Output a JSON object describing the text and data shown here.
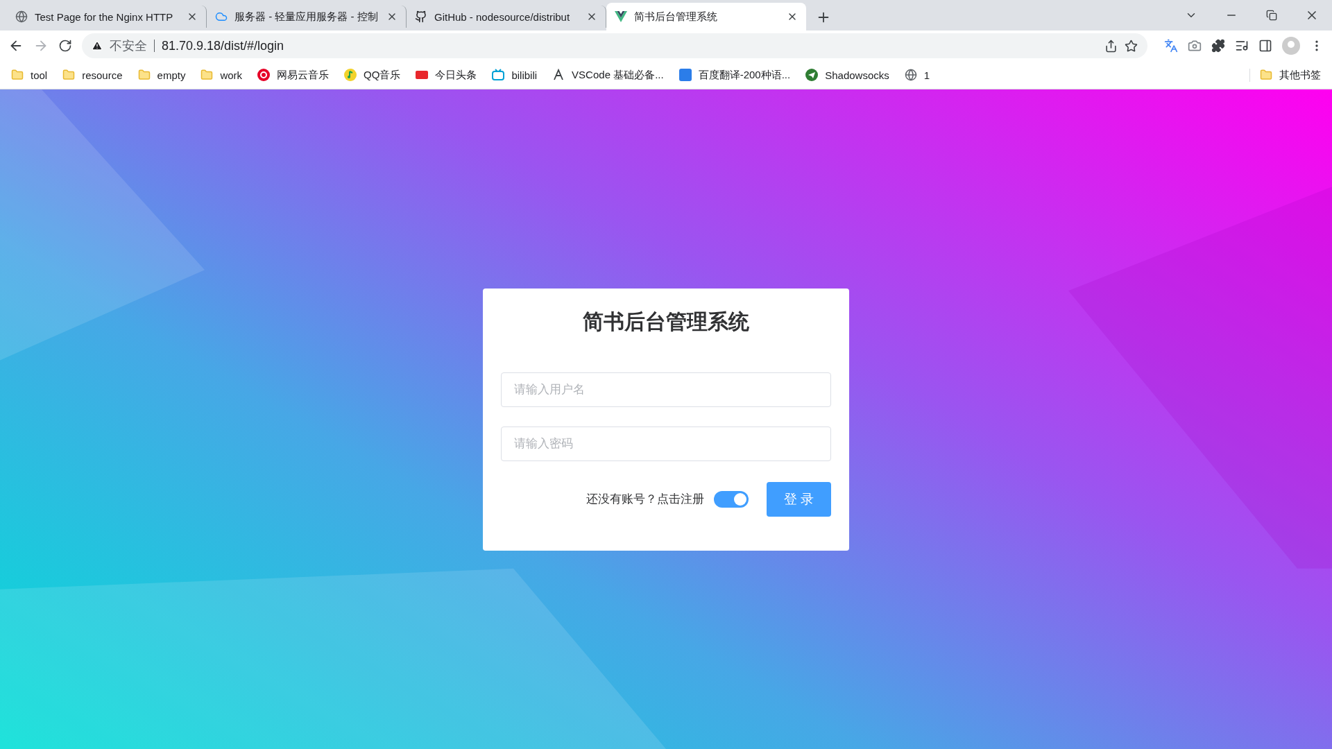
{
  "tabs": [
    {
      "title": "Test Page for the Nginx HTTP",
      "kind": "globe",
      "selected": false
    },
    {
      "title": "服务器 - 轻量应用服务器 - 控制",
      "kind": "cloud",
      "selected": false
    },
    {
      "title": "GitHub - nodesource/distribut",
      "kind": "github",
      "selected": false
    },
    {
      "title": "简书后台管理系统",
      "kind": "vue",
      "selected": true
    }
  ],
  "address_bar": {
    "security": "不安全",
    "url": "81.70.9.18/dist/#/login"
  },
  "bookmarks": [
    {
      "label": "tool",
      "kind": "folder"
    },
    {
      "label": "resource",
      "kind": "folder"
    },
    {
      "label": "empty",
      "kind": "folder"
    },
    {
      "label": "work",
      "kind": "folder"
    },
    {
      "label": "网易云音乐",
      "kind": "netease"
    },
    {
      "label": "QQ音乐",
      "kind": "qqmusic"
    },
    {
      "label": "今日头条",
      "kind": "toutiao"
    },
    {
      "label": "bilibili",
      "kind": "bilibili"
    },
    {
      "label": "VSCode 基础必备...",
      "kind": "vscode"
    },
    {
      "label": "百度翻译-200种语...",
      "kind": "baidu"
    },
    {
      "label": "Shadowsocks",
      "kind": "shadowsocks"
    },
    {
      "label": "1",
      "kind": "globe"
    }
  ],
  "other_bookmarks": "其他书签",
  "login": {
    "title": "简书后台管理系统",
    "username_placeholder": "请输入用户名",
    "password_placeholder": "请输入密码",
    "register_text": "还没有账号？点击注册",
    "register_toggle": {
      "on": true
    },
    "submit": "登 录"
  }
}
